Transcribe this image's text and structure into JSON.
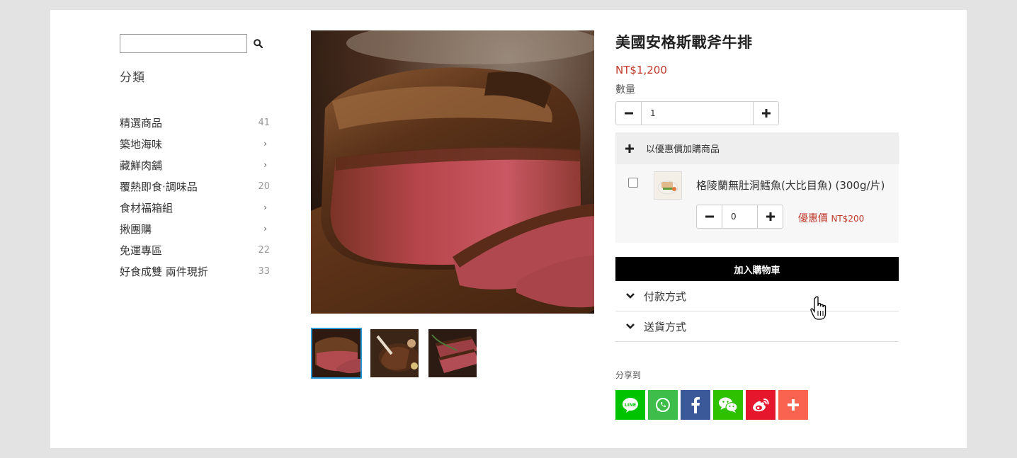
{
  "sidebar": {
    "search": {
      "value": "",
      "placeholder": ""
    },
    "category_title": "分類",
    "categories": [
      {
        "label": "精選商品",
        "count": "41",
        "chevron": ""
      },
      {
        "label": "築地海味",
        "count": "",
        "chevron": "›"
      },
      {
        "label": "藏鮮肉舖",
        "count": "",
        "chevron": "›"
      },
      {
        "label": "覆熱即食·調味品",
        "count": "20",
        "chevron": ""
      },
      {
        "label": "食材福箱組",
        "count": "",
        "chevron": "›"
      },
      {
        "label": "揪團購",
        "count": "",
        "chevron": "›"
      },
      {
        "label": "免運專區",
        "count": "22",
        "chevron": ""
      },
      {
        "label": "好食成雙 兩件現折",
        "count": "33",
        "chevron": ""
      }
    ]
  },
  "product": {
    "title": "美國安格斯戰斧牛排",
    "price": "NT$1,200",
    "quantity_label": "數量",
    "quantity": "1",
    "minus": "−",
    "plus": "+"
  },
  "addon": {
    "header_label": "以優惠價加購商品",
    "item": {
      "name": "格陵蘭無肚洞鱈魚(大比目魚) (300g/片)",
      "quantity": "0",
      "price_prefix": "優惠價",
      "price": "NT$200"
    }
  },
  "add_to_cart_label": "加入購物車",
  "accordions": [
    {
      "label": "付款方式"
    },
    {
      "label": "送貨方式"
    }
  ],
  "share": {
    "label": "分享到",
    "buttons": [
      {
        "name": "line",
        "text": "LINE",
        "color": "#00c300"
      },
      {
        "name": "whatsapp",
        "text": "",
        "color": "#3fbd4a"
      },
      {
        "name": "facebook",
        "text": "f",
        "color": "#3b5998"
      },
      {
        "name": "wechat",
        "text": "",
        "color": "#2dc100"
      },
      {
        "name": "weibo",
        "text": "",
        "color": "#e6162d"
      },
      {
        "name": "more",
        "text": "+",
        "color": "#fa6350"
      }
    ]
  }
}
